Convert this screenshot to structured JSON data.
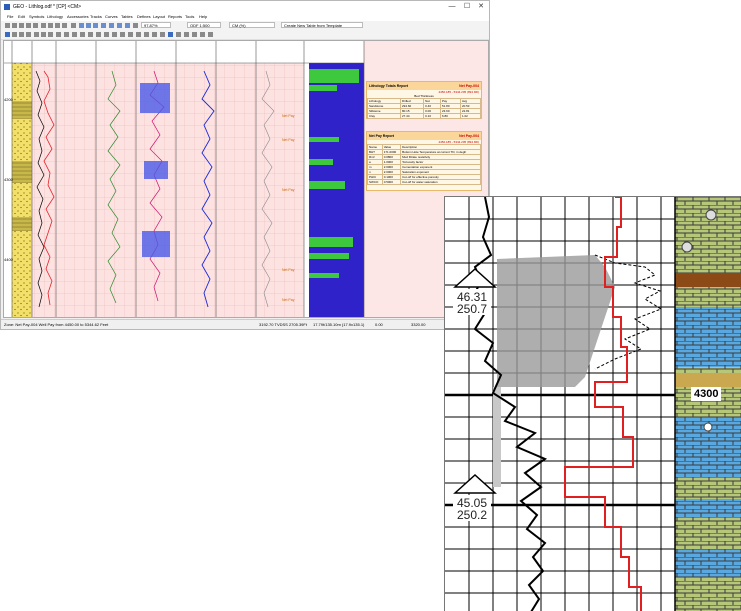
{
  "window": {
    "title": "GEO - Lithlog.odf * [CP] <CM>",
    "min_btn": "—",
    "max_btn": "☐",
    "close_btn": "✕"
  },
  "menu": [
    "File",
    "Edit",
    "Symbols",
    "Lithology",
    "Accessories",
    "Tracks",
    "Curves",
    "Tables",
    "Defines",
    "Layout",
    "Reports",
    "Tools",
    "Help"
  ],
  "toolbar": {
    "zoom_value": "97.87%",
    "odf_value": "ODF 1:500",
    "cm_value": "CM (%)",
    "template_value": "Create New Table from Template"
  },
  "depth_labels": [
    "4200",
    "4300",
    "4400"
  ],
  "net_pay_label": "Net Pay",
  "lithology_report": {
    "title": "Lithology Totals Report",
    "subtitle": "Net Pay-004",
    "range": "4450.185 - 5344.205 (894 Mft)",
    "group_header": "Bed Thickness",
    "headers": [
      "Lithology",
      "Drilled",
      "Net",
      "Pay",
      "Avg"
    ],
    "rows": [
      [
        "Sandstone",
        "294.60",
        "0.40",
        "51.80",
        "20.53"
      ],
      [
        "Siltstone",
        "80.15",
        "0.00",
        "23.60",
        "22.81"
      ],
      [
        "Clay",
        "27.44",
        "0.10",
        "6.80",
        "1.02"
      ]
    ]
  },
  "netpay_report": {
    "title": "Net Pay Report",
    "subtitle": "Net Pay-004",
    "range": "4450.185 - 5344.205 (894 Mft)",
    "headers": [
      "Name",
      "Value",
      "Description"
    ],
    "rows": [
      [
        "BHT",
        "171.0000",
        "Bottom Hole Temperature at current TD, in degF"
      ],
      [
        "Rmf",
        "0.0800",
        "Mud filtrate resistivity"
      ],
      [
        "a",
        "1.0000",
        "Tortuosity factor"
      ],
      [
        "m",
        "2.0000",
        "Cementation exponent"
      ],
      [
        "n",
        "2.0000",
        "Saturation exponent"
      ],
      [
        "PHIC",
        "0.1000",
        "Cut-off for effective porosity"
      ],
      [
        "SWCO",
        "0.5000",
        "Cut-off for water saturation"
      ]
    ]
  },
  "status": {
    "left": "Zone: Net Pay-004 Well Pay from 4450.00 to 5344.62 Feet",
    "coords": "3192.70 TVDSS 2705.39Ft",
    "scale": "17.79t/135.10m (17.9x135.1)",
    "v1": "0.00",
    "v2": "3320.00"
  },
  "zoom": {
    "top_label_1": "46.31",
    "top_label_2": "250.7",
    "bottom_label_1": "45.05",
    "bottom_label_2": "250.2",
    "depth": "4300"
  }
}
